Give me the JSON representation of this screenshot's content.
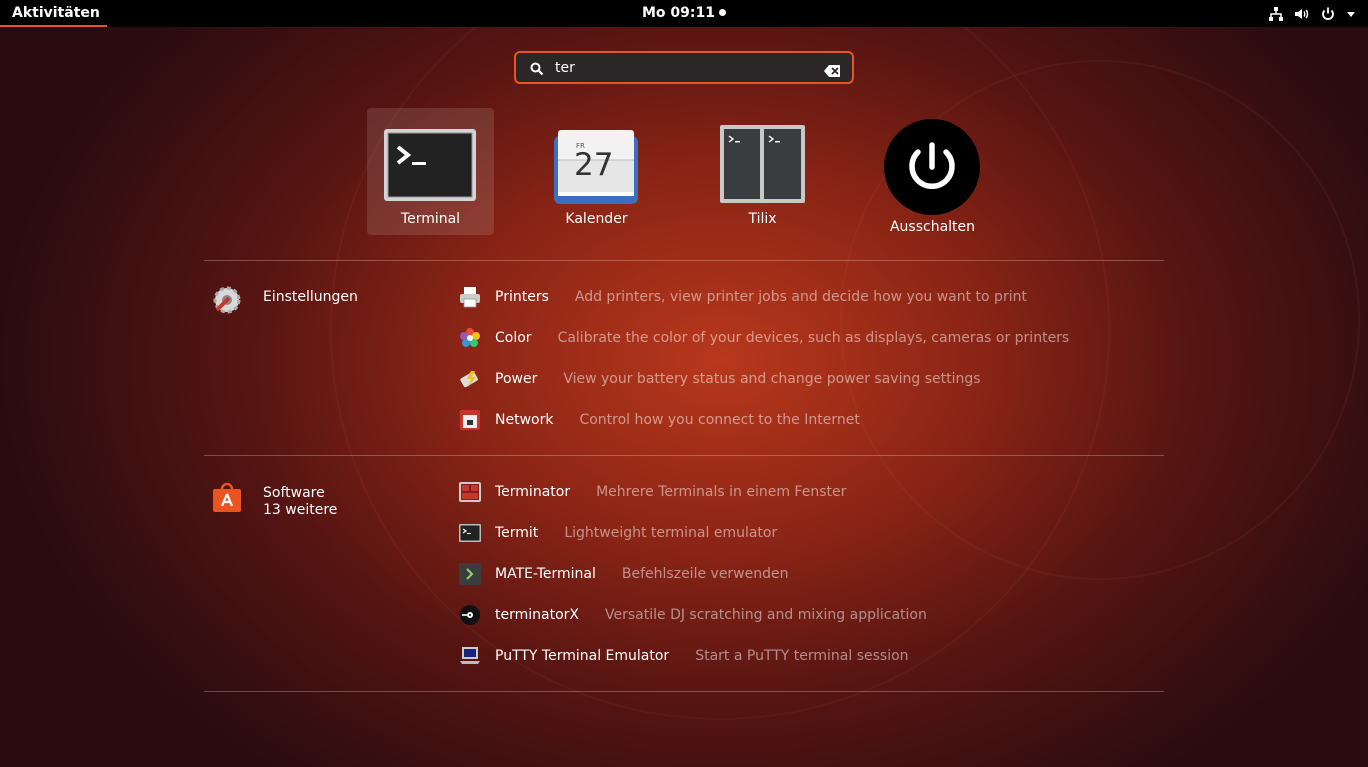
{
  "topbar": {
    "activities": "Aktivitäten",
    "clock": "Mo 09:11",
    "tray_icons": [
      "network-icon",
      "volume-icon",
      "power-icon",
      "chevron-down-icon"
    ]
  },
  "search": {
    "value": "ter",
    "placeholder": ""
  },
  "apps": [
    {
      "label": "Terminal",
      "icon": "terminal-icon",
      "selected": true
    },
    {
      "label": "Kalender",
      "icon": "calendar-icon",
      "calendar_day": "FR",
      "calendar_date": "27"
    },
    {
      "label": "Tilix",
      "icon": "tilix-icon"
    },
    {
      "label": "Ausschalten",
      "icon": "power-off-icon"
    }
  ],
  "providers": [
    {
      "name": "Einstellungen",
      "icon": "settings-icon",
      "results": [
        {
          "name": "Printers",
          "icon": "printer-icon",
          "description": "Add printers, view printer jobs and decide how you want to print"
        },
        {
          "name": "Color",
          "icon": "color-icon",
          "description": "Calibrate the color of your devices, such as displays, cameras or printers"
        },
        {
          "name": "Power",
          "icon": "power-settings-icon",
          "description": "View your battery status and change power saving settings"
        },
        {
          "name": "Network",
          "icon": "network-settings-icon",
          "description": "Control how you connect to the Internet"
        }
      ]
    },
    {
      "name": "Software",
      "more": "13 weitere",
      "icon": "software-icon",
      "results": [
        {
          "name": "Terminator",
          "icon": "terminator-icon",
          "description": "Mehrere Terminals in einem Fenster"
        },
        {
          "name": "Termit",
          "icon": "termit-icon",
          "description": "Lightweight terminal emulator"
        },
        {
          "name": "MATE-Terminal",
          "icon": "mate-terminal-icon",
          "description": "Befehlszeile verwenden"
        },
        {
          "name": "terminatorX",
          "icon": "terminatorx-icon",
          "description": "Versatile DJ scratching and mixing application"
        },
        {
          "name": "PuTTY Terminal Emulator",
          "icon": "putty-icon",
          "description": "Start a PuTTY terminal session"
        }
      ]
    }
  ],
  "colors": {
    "accent": "#e95420",
    "topbar": "#000000",
    "search_bg": "#2b2728"
  }
}
